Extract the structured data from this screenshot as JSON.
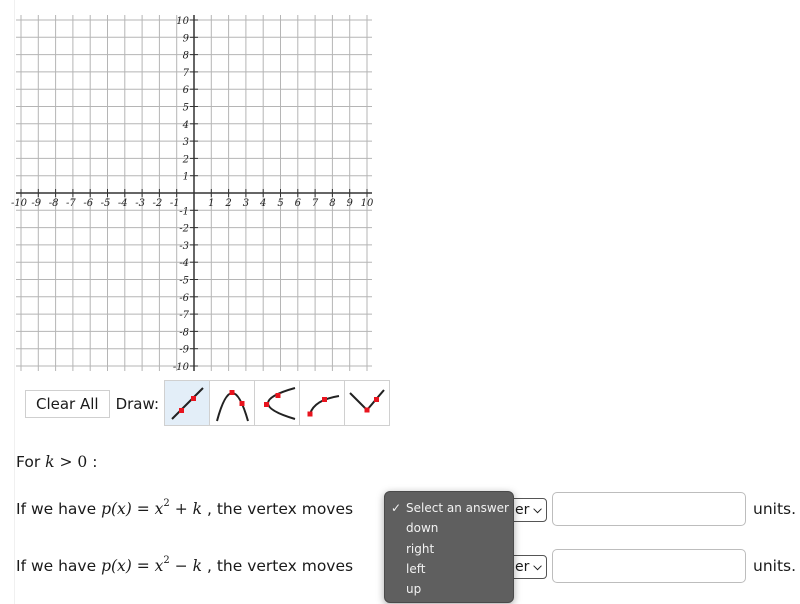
{
  "graph": {
    "x_min": -10,
    "x_max": 10,
    "y_min": -10,
    "y_max": 10,
    "x_tick_labels": [
      "-10",
      "-9",
      "-8",
      "-7",
      "-6",
      "-5",
      "-4",
      "-3",
      "-2",
      "-1",
      "1",
      "2",
      "3",
      "4",
      "5",
      "6",
      "7",
      "8",
      "9",
      "10"
    ],
    "y_tick_labels": [
      "10",
      "9",
      "8",
      "7",
      "6",
      "5",
      "4",
      "3",
      "2",
      "1",
      "-1",
      "-2",
      "-3",
      "-4",
      "-5",
      "-6",
      "-7",
      "-8",
      "-9",
      "-10"
    ],
    "grid_color": "#b5b5b5",
    "axis_color": "#333333"
  },
  "toolbar": {
    "clear_label": "Clear All",
    "draw_label": "Draw:",
    "tools": [
      {
        "name": "line-tool-icon",
        "selected": true
      },
      {
        "name": "parabola-tool-icon",
        "selected": false
      },
      {
        "name": "sideways-parabola-tool-icon",
        "selected": false
      },
      {
        "name": "square-root-tool-icon",
        "selected": false
      },
      {
        "name": "absolute-value-tool-icon",
        "selected": false
      }
    ],
    "point_color": "#e8141e"
  },
  "question": {
    "intro_prefix": "For ",
    "intro_var": "k",
    "intro_rel": " > 0",
    "intro_suffix": " :",
    "rows": [
      {
        "prefix": "If we have ",
        "fn": "p(x)",
        "eq": " = ",
        "base": "x",
        "exp": "2",
        "op": " + ",
        "k": "k",
        "suffix": " , the vertex moves",
        "select_visible_text": "er",
        "select_chevron": "⌄",
        "input_value": "",
        "units": "units."
      },
      {
        "prefix": "If we have ",
        "fn": "p(x)",
        "eq": " = ",
        "base": "x",
        "exp": "2",
        "op": " − ",
        "k": "k",
        "suffix": " , the vertex moves",
        "select_visible_text": "er",
        "select_chevron": "⌄",
        "input_value": "",
        "units": "units."
      }
    ]
  },
  "dropdown": {
    "check": "✓",
    "options": [
      "Select an answer",
      "down",
      "right",
      "left",
      "up"
    ],
    "selected_index": 0
  }
}
